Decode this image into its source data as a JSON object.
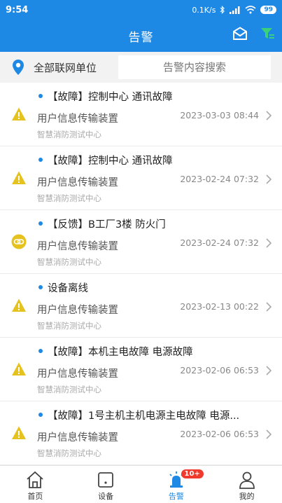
{
  "status": {
    "time": "9:54",
    "speed": "0.1K/s",
    "battery": "99"
  },
  "header": {
    "title": "告警"
  },
  "filter": {
    "unit_label": "全部联网单位",
    "search_placeholder": "告警内容搜索"
  },
  "alarms": [
    {
      "type_icon": "warning-icon",
      "title": "【故障】控制中心 通讯故障",
      "device": "用户信息传输装置",
      "time": "2023-03-03 08:44",
      "org": "智慧消防测试中心"
    },
    {
      "type_icon": "warning-icon",
      "title": "【故障】控制中心 通讯故障",
      "device": "用户信息传输装置",
      "time": "2023-02-24 07:32",
      "org": "智慧消防测试中心"
    },
    {
      "type_icon": "link-icon",
      "title": "【反馈】B工厂3楼 防火门",
      "device": "用户信息传输装置",
      "time": "2023-02-24 07:32",
      "org": "智慧消防测试中心"
    },
    {
      "type_icon": "warning-icon",
      "title": "设备离线",
      "device": "用户信息传输装置",
      "time": "2023-02-13 00:22",
      "org": "智慧消防测试中心"
    },
    {
      "type_icon": "warning-icon",
      "title": "【故障】本机主电故障 电源故障",
      "device": "用户信息传输装置",
      "time": "2023-02-06 06:53",
      "org": "智慧消防测试中心"
    },
    {
      "type_icon": "warning-icon",
      "title": "【故障】1号主机主机电源主电故障 电源...",
      "device": "用户信息传输装置",
      "time": "2023-02-06 06:53",
      "org": "智慧消防测试中心"
    }
  ],
  "tabbar": {
    "home": "首页",
    "device": "设备",
    "alarm": "告警",
    "alarm_badge": "10+",
    "mine": "我的"
  },
  "colors": {
    "primary": "#1e88e5",
    "warning": "#e6c21e",
    "filter_icon": "#3ad07a",
    "badge": "#f03a2e"
  }
}
